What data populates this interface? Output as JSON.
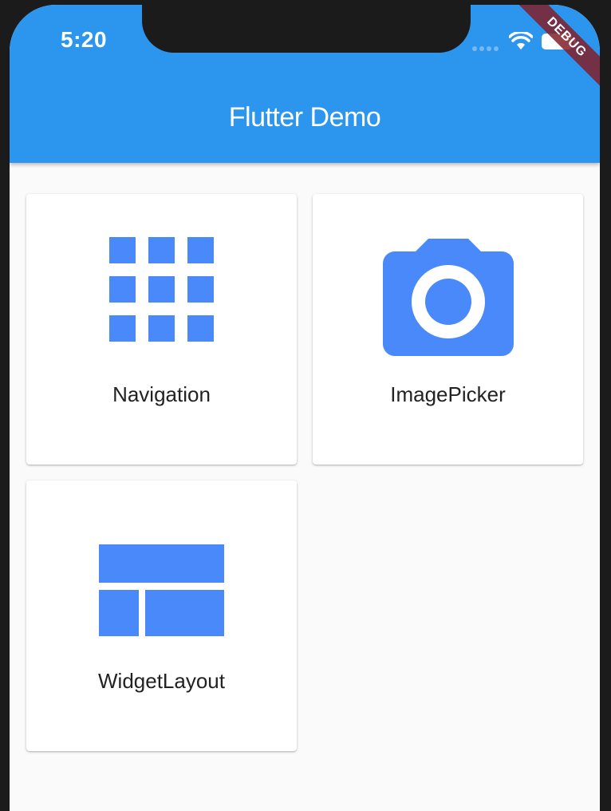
{
  "status_bar": {
    "time": "5:20"
  },
  "debug_banner": {
    "text": "DEBUG"
  },
  "app_bar": {
    "title": "Flutter Demo",
    "color": "#2c96ee"
  },
  "accent_color": "#4a89fa",
  "menu": {
    "items": [
      {
        "label": "Navigation",
        "icon": "apps-grid-icon"
      },
      {
        "label": "ImagePicker",
        "icon": "camera-icon"
      },
      {
        "label": "WidgetLayout",
        "icon": "layout-icon"
      }
    ]
  }
}
